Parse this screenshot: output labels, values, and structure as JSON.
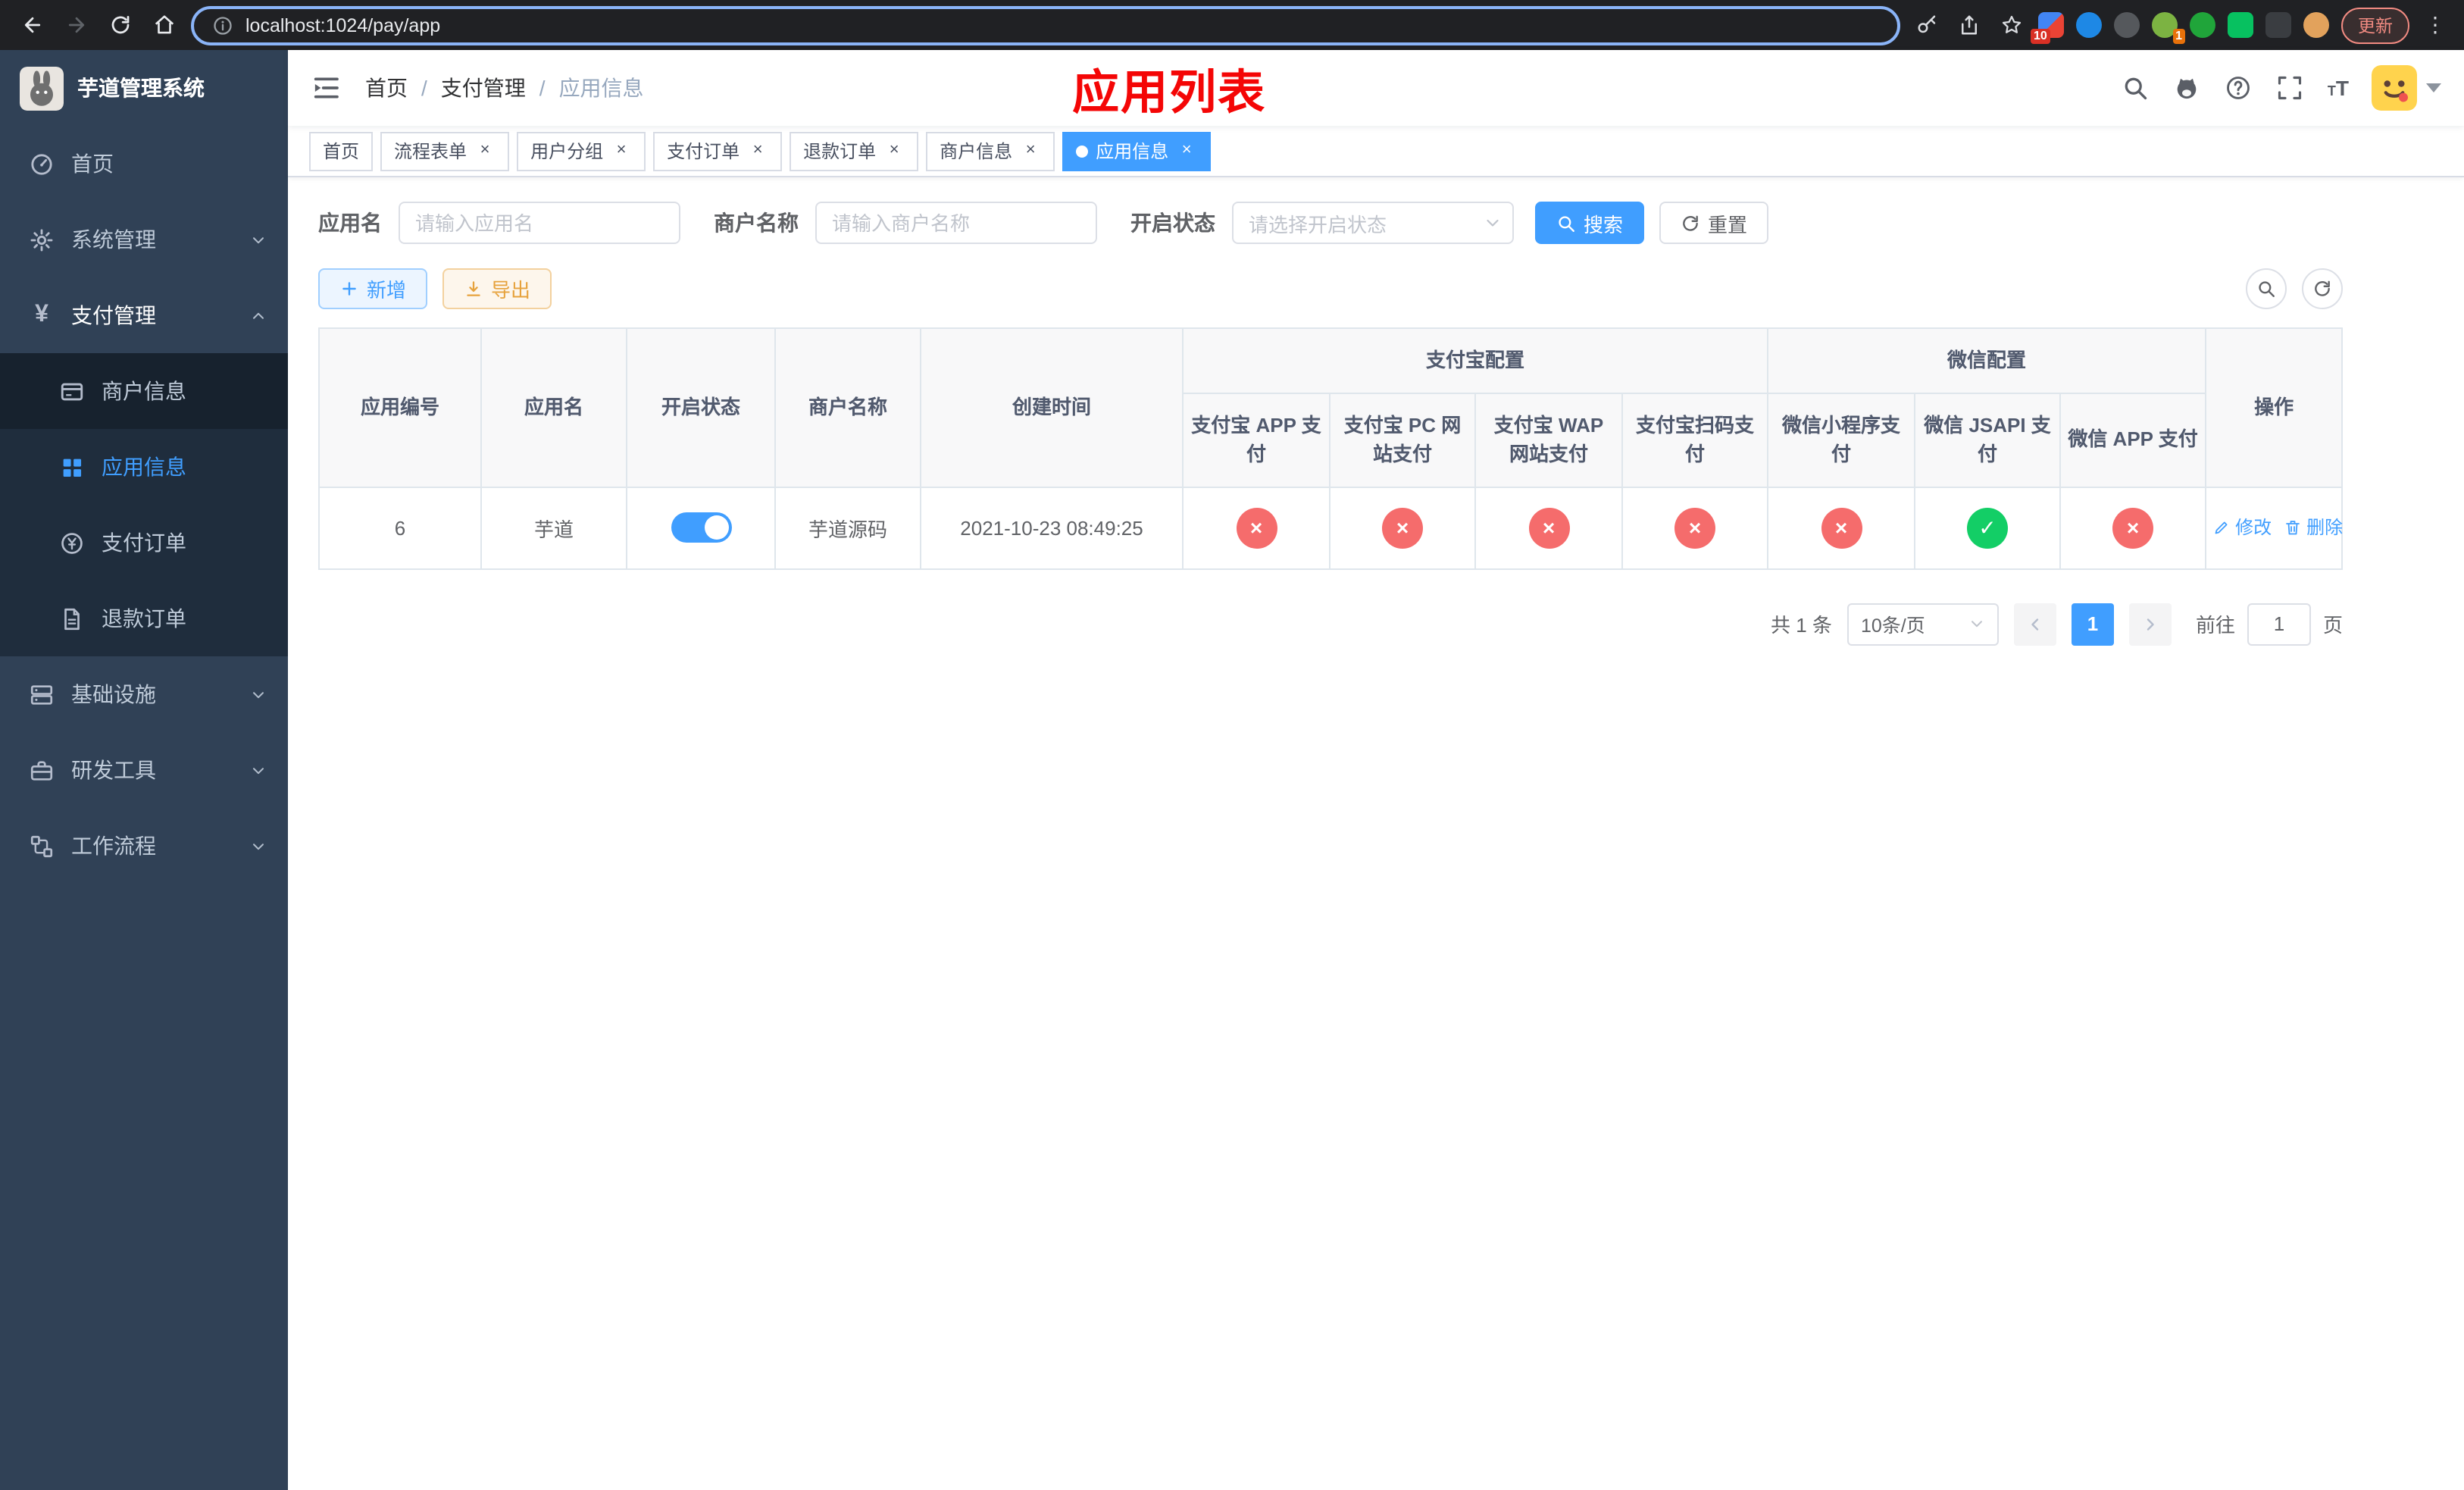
{
  "browser": {
    "url": "localhost:1024/pay/app",
    "update_button": "更新",
    "extension_badge_1": "10",
    "extension_badge_2": "1"
  },
  "app": {
    "title": "芋道管理系统"
  },
  "sidebar": {
    "items": [
      {
        "label": "首页"
      },
      {
        "label": "系统管理"
      },
      {
        "label": "支付管理"
      },
      {
        "label": "基础设施"
      },
      {
        "label": "研发工具"
      },
      {
        "label": "工作流程"
      }
    ],
    "payment_children": [
      {
        "label": "商户信息"
      },
      {
        "label": "应用信息"
      },
      {
        "label": "支付订单"
      },
      {
        "label": "退款订单"
      }
    ]
  },
  "header": {
    "breadcrumb": [
      "首页",
      "支付管理",
      "应用信息"
    ],
    "overlay_title": "应用列表"
  },
  "tabs": [
    {
      "label": "首页"
    },
    {
      "label": "流程表单"
    },
    {
      "label": "用户分组"
    },
    {
      "label": "支付订单"
    },
    {
      "label": "退款订单"
    },
    {
      "label": "商户信息"
    },
    {
      "label": "应用信息"
    }
  ],
  "filters": {
    "app_name_label": "应用名",
    "app_name_placeholder": "请输入应用名",
    "merchant_label": "商户名称",
    "merchant_placeholder": "请输入商户名称",
    "status_label": "开启状态",
    "status_placeholder": "请选择开启状态",
    "search_button": "搜索",
    "reset_button": "重置"
  },
  "toolbar": {
    "add_button": "新增",
    "export_button": "导出"
  },
  "table": {
    "group_headers": {
      "alipay": "支付宝配置",
      "wechat": "微信配置"
    },
    "columns": {
      "app_id": "应用编号",
      "app_name": "应用名",
      "status": "开启状态",
      "merchant": "商户名称",
      "created": "创建时间",
      "alipay_app": "支付宝 APP 支付",
      "alipay_pc": "支付宝 PC 网站支付",
      "alipay_wap": "支付宝 WAP 网站支付",
      "alipay_qr": "支付宝扫码支付",
      "wechat_mini": "微信小程序支付",
      "wechat_jsapi": "微信 JSAPI 支付",
      "wechat_app": "微信 APP 支付",
      "actions": "操作"
    },
    "rows": [
      {
        "app_id": "6",
        "app_name": "芋道",
        "enabled": true,
        "merchant": "芋道源码",
        "created": "2021-10-23 08:49:25",
        "configs": [
          "disabled",
          "disabled",
          "disabled",
          "disabled",
          "disabled",
          "enabled",
          "disabled"
        ],
        "edit_label": "修改",
        "delete_label": "删除"
      }
    ]
  },
  "pagination": {
    "total": "共 1 条",
    "page_size": "10条/页",
    "current_page": "1",
    "goto_label": "前往",
    "goto_value": "1",
    "goto_suffix": "页"
  },
  "colors": {
    "accent": "#409eff",
    "error": "#f56c6c",
    "success": "#13ce66",
    "title_red": "#f40606",
    "sidebar_bg": "#304156",
    "submenu_bg": "#1f2d3d"
  }
}
